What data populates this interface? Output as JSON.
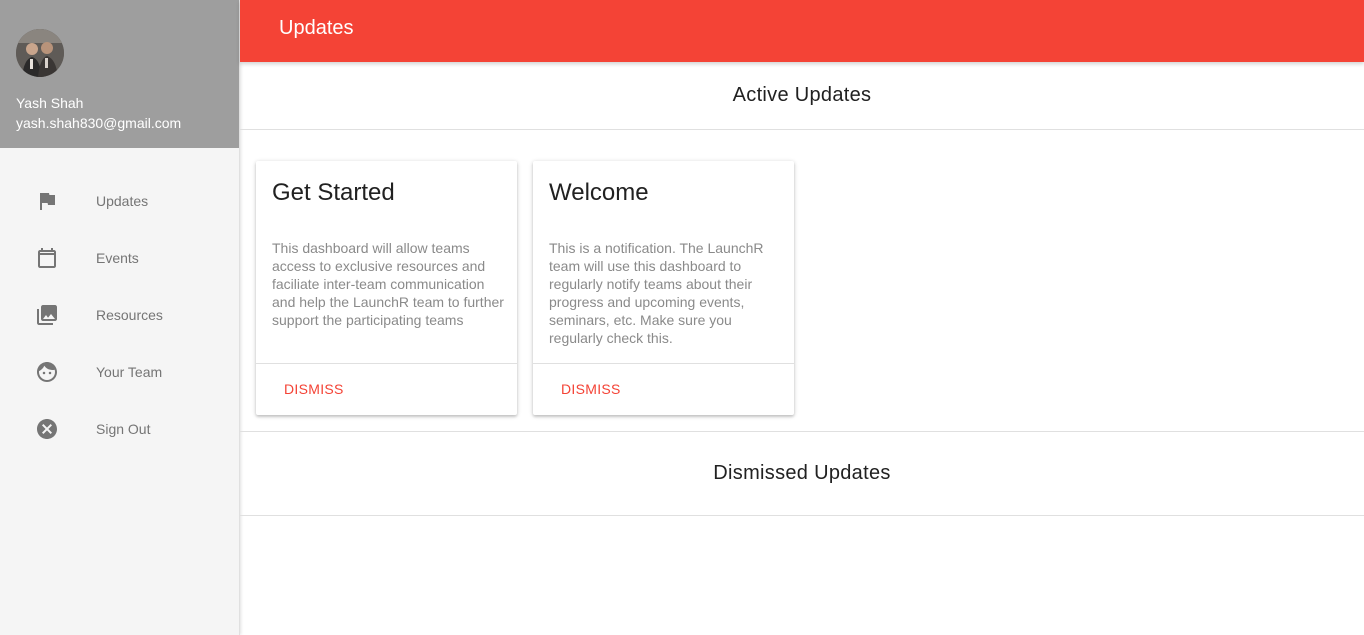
{
  "user": {
    "name": "Yash Shah",
    "email": "yash.shah830@gmail.com"
  },
  "sidebar": {
    "items": [
      {
        "label": "Updates",
        "icon": "flag-icon"
      },
      {
        "label": "Events",
        "icon": "calendar-icon"
      },
      {
        "label": "Resources",
        "icon": "photo-library-icon"
      },
      {
        "label": "Your Team",
        "icon": "face-icon"
      },
      {
        "label": "Sign Out",
        "icon": "cancel-icon"
      }
    ]
  },
  "topbar": {
    "title": "Updates"
  },
  "active_updates": {
    "heading": "Active Updates",
    "cards": [
      {
        "title": "Get Started",
        "body": "This dashboard will allow teams access to exclusive resources and faciliate inter-team communication and help the LaunchR team to further support the participating teams",
        "action": "DISMISS"
      },
      {
        "title": "Welcome",
        "body": "This is a notification. The LaunchR team will use this dashboard to regularly notify teams about their progress and upcoming events, seminars, etc. Make sure you regularly check this.",
        "action": "DISMISS"
      }
    ]
  },
  "dismissed_updates": {
    "heading": "Dismissed Updates"
  },
  "colors": {
    "accent": "#f44336",
    "sidebar_header": "#9e9e9e",
    "sidebar_bg": "#f5f5f5"
  }
}
